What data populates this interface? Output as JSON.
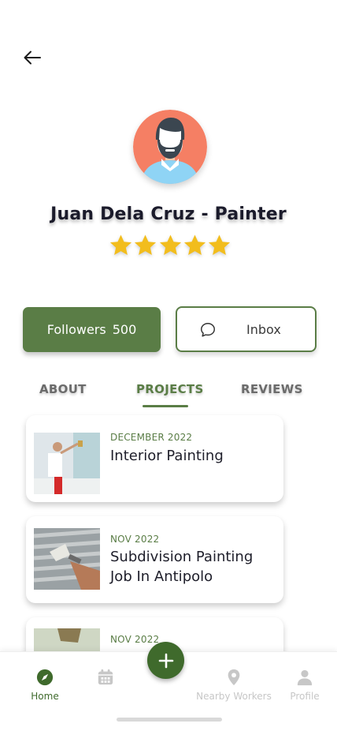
{
  "header": {
    "back_icon": "arrow-left-icon"
  },
  "profile": {
    "name": "Juan Dela Cruz - Painter",
    "rating": 5,
    "rating_max": 5,
    "avatar_icon": "avatar-man-icon"
  },
  "actions": {
    "followers_label": "Followers",
    "followers_count": "500",
    "inbox_label": "Inbox",
    "inbox_icon": "chat-bubble-icon"
  },
  "tabs": [
    {
      "label": "ABOUT",
      "active": false
    },
    {
      "label": "PROJECTS",
      "active": true
    },
    {
      "label": "REVIEWS",
      "active": false
    }
  ],
  "projects": [
    {
      "date": "DECEMBER 2022",
      "title": "Interior Painting"
    },
    {
      "date": "NOV 2022",
      "title": "Subdivision Painting Job In Antipolo"
    },
    {
      "date": "NOV 2022",
      "title": ""
    }
  ],
  "bottom_nav": {
    "items": [
      {
        "label": "Home",
        "icon": "compass-icon",
        "active": true
      },
      {
        "label": "",
        "icon": "calendar-icon",
        "active": false
      },
      {
        "label": "Nearby Workers",
        "icon": "map-pin-icon",
        "active": false
      },
      {
        "label": "Profile",
        "icon": "user-icon",
        "active": false
      }
    ],
    "fab_icon": "plus-icon"
  },
  "colors": {
    "primary": "#5a7d46",
    "primary_dark": "#3f6a2c",
    "star": "#f2bd1d",
    "avatar_bg": "#f57f64",
    "inactive": "#c7c7c7"
  }
}
